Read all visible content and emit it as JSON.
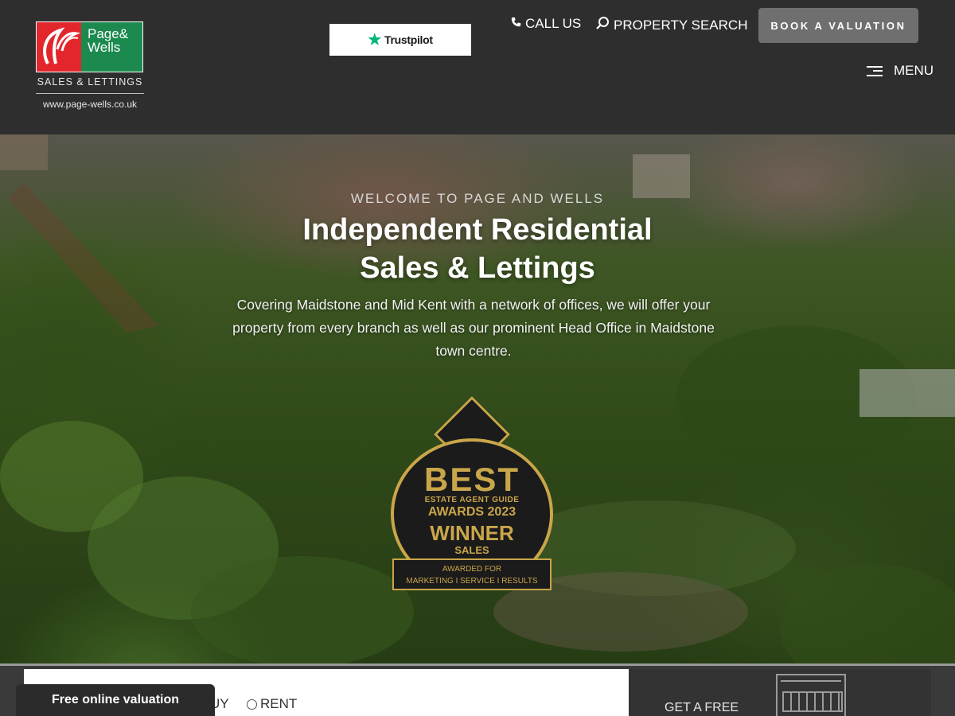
{
  "header": {
    "logo": {
      "name_line1": "Page&",
      "name_line2": "Wells",
      "tagline": "SALES & LETTINGS",
      "url": "www.page-wells.co.uk"
    },
    "trustpilot_label": "Trustpilot",
    "nav": {
      "call_label": "CALL US",
      "search_label": "PROPERTY SEARCH",
      "book_label": "BOOK A VALUATION",
      "menu_label": "MENU"
    }
  },
  "hero": {
    "welcome": "WELCOME TO PAGE AND WELLS",
    "headline_line1": "Independent Residential",
    "headline_line2": "Sales & Lettings",
    "intro": "Covering Maidstone and Mid Kent with a network of offices, we will offer your property from every branch as well as our prominent Head Office in Maidstone town centre.",
    "badge": {
      "best": "BEST",
      "guide": "ESTATE AGENT GUIDE",
      "awards": "AWARDS 2023",
      "winner": "WINNER",
      "sales": "SALES",
      "awarded_for": "AWARDED FOR",
      "criteria": "MARKETING I SERVICE I RESULTS"
    }
  },
  "search": {
    "buy_label": "UY",
    "rent_label": "RENT"
  },
  "valuation_tab_label": "Free online valuation",
  "free_panel_text": "GET A FREE",
  "colors": {
    "header_bg": "#2e2e2e",
    "brand_red": "#e3262b",
    "brand_green": "#1c8a4e",
    "trustpilot_green": "#00b67a",
    "badge_gold": "#c9a64a",
    "book_button_bg": "#6f6f6f"
  },
  "icons": {
    "call": "phone-icon",
    "search": "magnifier-icon",
    "menu": "hamburger-icon",
    "trustpilot": "star-icon",
    "valuation": "house-icon"
  }
}
